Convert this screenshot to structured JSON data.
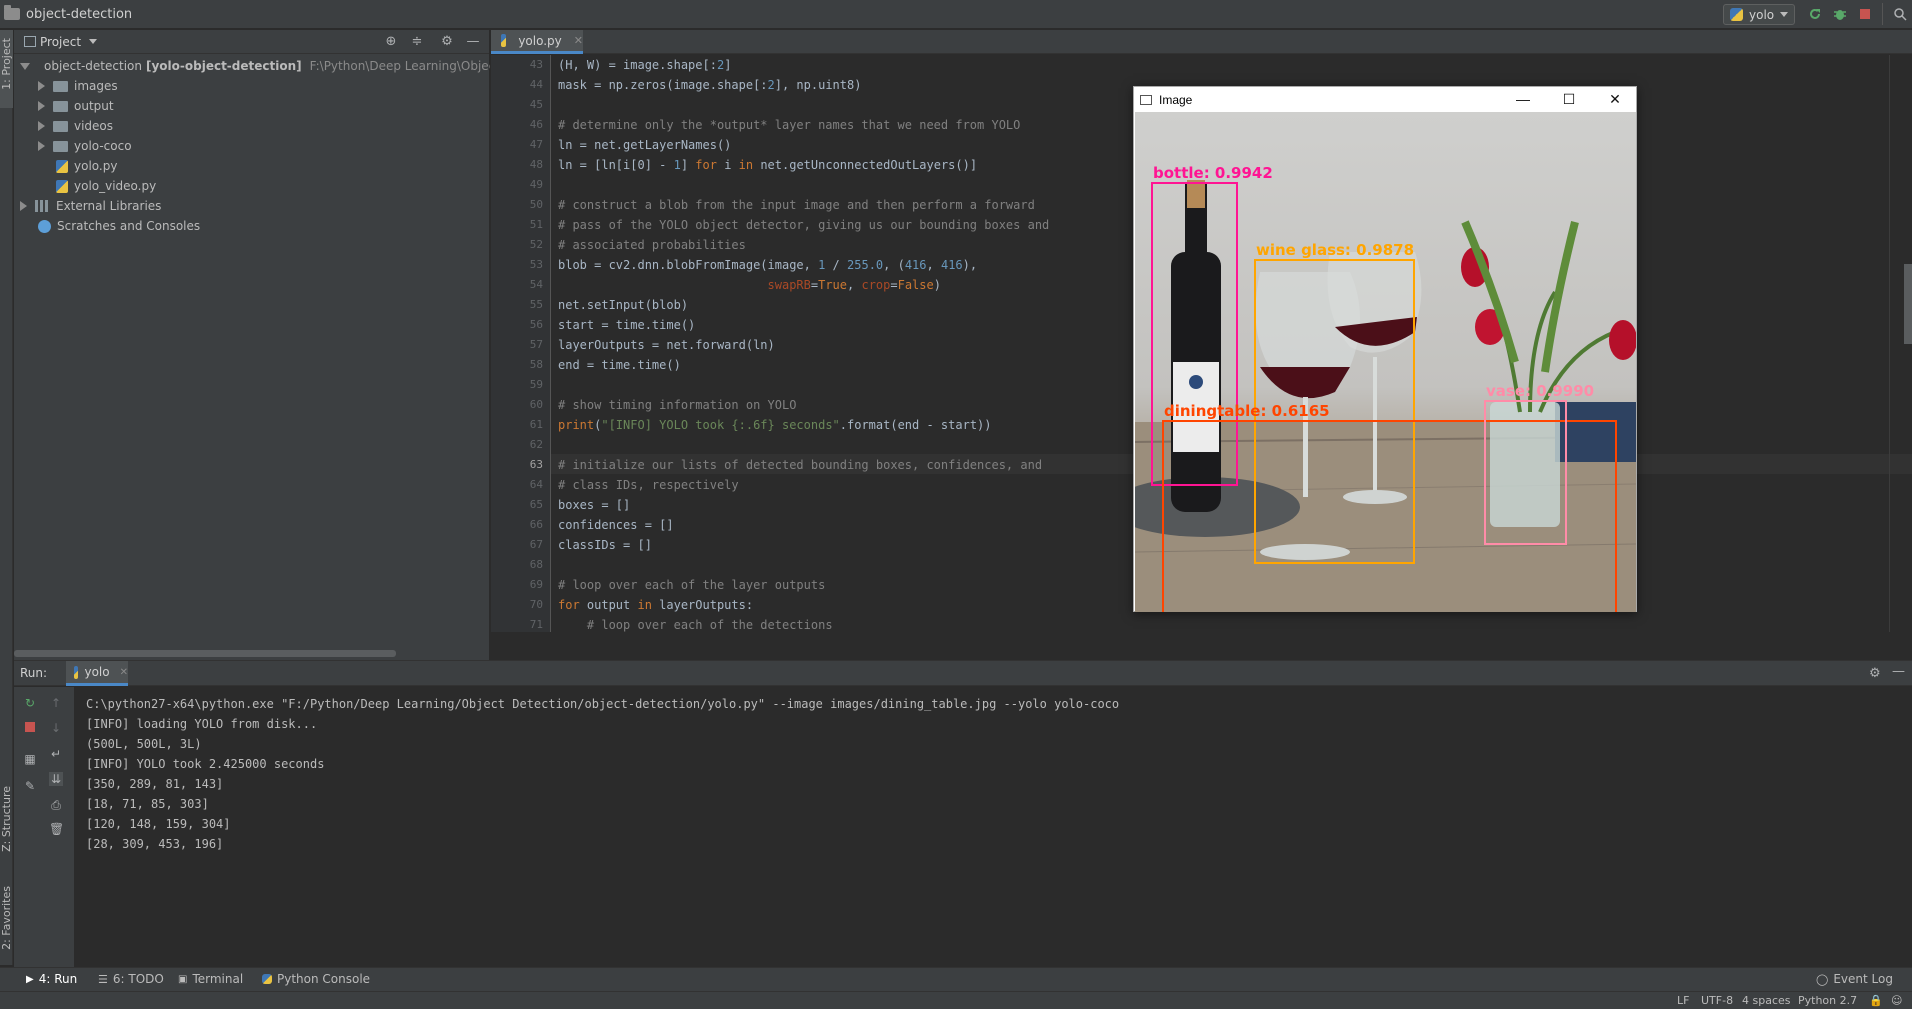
{
  "titlebar": {
    "project_name": "object-detection",
    "run_config": "yolo"
  },
  "left_strip": {
    "project_label": "1: Project",
    "structure_label": "Z: Structure",
    "favorites_label": "2: Favorites"
  },
  "project_panel": {
    "header": "Project",
    "tree": [
      {
        "label": "object-detection",
        "extra": "[yolo-object-detection]",
        "path": "F:\\Python\\Deep Learning\\Object Detecti",
        "type": "root"
      },
      {
        "label": "images",
        "type": "folder"
      },
      {
        "label": "output",
        "type": "folder"
      },
      {
        "label": "videos",
        "type": "folder"
      },
      {
        "label": "yolo-coco",
        "type": "folder"
      },
      {
        "label": "yolo.py",
        "type": "pyfile"
      },
      {
        "label": "yolo_video.py",
        "type": "pyfile"
      },
      {
        "label": "External Libraries",
        "type": "lib"
      },
      {
        "label": "Scratches and Consoles",
        "type": "scratch"
      }
    ]
  },
  "editor": {
    "tab": "yolo.py",
    "current_line": "63",
    "lines": [
      {
        "n": "43",
        "t": "(H, W) = image.shape[:2]"
      },
      {
        "n": "44",
        "t": "mask = np.zeros(image.shape[:2], np.uint8)"
      },
      {
        "n": "45",
        "t": ""
      },
      {
        "n": "46",
        "t": "# determine only the *output* layer names that we need from YOLO"
      },
      {
        "n": "47",
        "t": "ln = net.getLayerNames()"
      },
      {
        "n": "48",
        "t": "ln = [ln[i[0] - 1] for i in net.getUnconnectedOutLayers()]"
      },
      {
        "n": "49",
        "t": ""
      },
      {
        "n": "50",
        "t": "# construct a blob from the input image and then perform a forward"
      },
      {
        "n": "51",
        "t": "# pass of the YOLO object detector, giving us our bounding boxes and"
      },
      {
        "n": "52",
        "t": "# associated probabilities"
      },
      {
        "n": "53",
        "t": "blob = cv2.dnn.blobFromImage(image, 1 / 255.0, (416, 416),"
      },
      {
        "n": "54",
        "t": "                             swapRB=True, crop=False)"
      },
      {
        "n": "55",
        "t": "net.setInput(blob)"
      },
      {
        "n": "56",
        "t": "start = time.time()"
      },
      {
        "n": "57",
        "t": "layerOutputs = net.forward(ln)"
      },
      {
        "n": "58",
        "t": "end = time.time()"
      },
      {
        "n": "59",
        "t": ""
      },
      {
        "n": "60",
        "t": "# show timing information on YOLO"
      },
      {
        "n": "61",
        "t": "print(\"[INFO] YOLO took {:.6f} seconds\".format(end - start))"
      },
      {
        "n": "62",
        "t": ""
      },
      {
        "n": "63",
        "t": "# initialize our lists of detected bounding boxes, confidences, and"
      },
      {
        "n": "64",
        "t": "# class IDs, respectively"
      },
      {
        "n": "65",
        "t": "boxes = []"
      },
      {
        "n": "66",
        "t": "confidences = []"
      },
      {
        "n": "67",
        "t": "classIDs = []"
      },
      {
        "n": "68",
        "t": ""
      },
      {
        "n": "69",
        "t": "# loop over each of the layer outputs"
      },
      {
        "n": "70",
        "t": "for output in layerOutputs:"
      },
      {
        "n": "71",
        "t": "    # loop over each of the detections"
      }
    ]
  },
  "image_window": {
    "title": "Image",
    "detections": [
      {
        "label": "bottle: 0.9942",
        "color": "#ff1493"
      },
      {
        "label": "wine glass: 0.9878",
        "color": "#ffa500"
      },
      {
        "label": "diningtable: 0.6165",
        "color": "#ff4500"
      },
      {
        "label": "vase: 0.9990",
        "color": "#ff8ca8"
      }
    ]
  },
  "run_panel": {
    "label": "Run:",
    "tab": "yolo",
    "console": [
      "C:\\python27-x64\\python.exe \"F:/Python/Deep Learning/Object Detection/object-detection/yolo.py\" --image images/dining_table.jpg --yolo yolo-coco",
      "[INFO] loading YOLO from disk...",
      "(500L, 500L, 3L)",
      "[INFO] YOLO took 2.425000 seconds",
      "[350, 289, 81, 143]",
      "[18, 71, 85, 303]",
      "[120, 148, 159, 304]",
      "[28, 309, 453, 196]"
    ]
  },
  "tool_buttons": {
    "run": "4: Run",
    "todo": "6: TODO",
    "terminal": "Terminal",
    "python_console": "Python Console",
    "event_log": "Event Log"
  },
  "status": {
    "line_sep": "LF",
    "encoding": "UTF-8",
    "indent": "4 spaces",
    "interpreter": "Python 2.7"
  }
}
